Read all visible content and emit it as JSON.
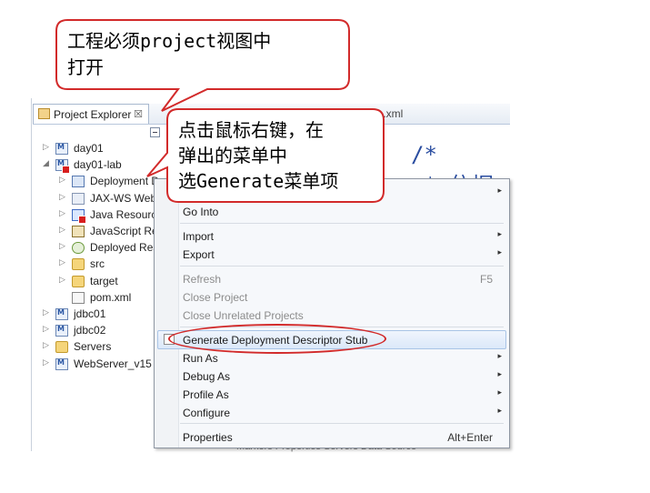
{
  "callouts": {
    "top": [
      "工程必须project视图中",
      "打开"
    ],
    "right": [
      "点击鼠标右键，在",
      "弹出的菜单中",
      "选Generate菜单项"
    ]
  },
  "explorer": {
    "tab_label": "Project Explorer",
    "tab_close": "☒",
    "editor_tab": "eb.xml",
    "tree": [
      {
        "label": "day01",
        "icon": "project-icon",
        "arrow": "▷"
      },
      {
        "label": "day01-lab",
        "icon": "project-icon",
        "arrow": "◢",
        "error": true
      },
      {
        "label": "Deployment D",
        "icon": "deployment-descriptor-icon",
        "arrow": "▷"
      },
      {
        "label": "JAX-WS Web S",
        "icon": "web-service-icon",
        "arrow": "▷"
      },
      {
        "label": "Java Resource",
        "icon": "java-resources-icon",
        "arrow": "▷",
        "error": true
      },
      {
        "label": "JavaScript Res",
        "icon": "javascript-icon",
        "arrow": "▷"
      },
      {
        "label": "Deployed Reso",
        "icon": "deployed-resources-icon",
        "arrow": "▷"
      },
      {
        "label": "src",
        "icon": "folder-icon",
        "arrow": "▷"
      },
      {
        "label": "target",
        "icon": "folder-icon",
        "arrow": "▷"
      },
      {
        "label": "pom.xml",
        "icon": "xml-file-icon",
        "arrow": ""
      },
      {
        "label": "jdbc01",
        "icon": "project-icon",
        "arrow": "▷"
      },
      {
        "label": "jdbc02",
        "icon": "project-icon",
        "arrow": "▷"
      },
      {
        "label": "Servers",
        "icon": "folder-icon",
        "arrow": "▷"
      },
      {
        "label": "WebServer_v15",
        "icon": "project-icon",
        "arrow": "▷"
      }
    ]
  },
  "editor": {
    "code_line1": "/*",
    "code_line2": "*  依据",
    "bottom_tabs": "Markers  Properties  Servers  Data Source"
  },
  "context_menu": {
    "items": [
      {
        "label": "Go Into",
        "submenu": false,
        "disabled": false,
        "accel": ""
      },
      {
        "label": "Import",
        "submenu": true,
        "disabled": false,
        "accel": ""
      },
      {
        "label": "Export",
        "submenu": true,
        "disabled": false,
        "accel": ""
      },
      {
        "label": "Refresh",
        "submenu": false,
        "disabled": true,
        "accel": "F5"
      },
      {
        "label": "Close Project",
        "submenu": false,
        "disabled": true,
        "accel": ""
      },
      {
        "label": "Close Unrelated Projects",
        "submenu": false,
        "disabled": true,
        "accel": ""
      },
      {
        "label": "Generate Deployment Descriptor Stub",
        "submenu": false,
        "disabled": false,
        "accel": "",
        "highlighted": true
      },
      {
        "label": "Run As",
        "submenu": true,
        "disabled": false,
        "accel": ""
      },
      {
        "label": "Debug As",
        "submenu": true,
        "disabled": false,
        "accel": ""
      },
      {
        "label": "Profile As",
        "submenu": true,
        "disabled": false,
        "accel": ""
      },
      {
        "label": "Configure",
        "submenu": true,
        "disabled": false,
        "accel": ""
      },
      {
        "label": "Properties",
        "submenu": false,
        "disabled": false,
        "accel": "Alt+Enter"
      }
    ],
    "submenu_arrow": "▸"
  },
  "colors": {
    "callout_border": "#d22a2a",
    "highlight_oval": "#d22a2a",
    "code_blue": "#2a4da0"
  }
}
